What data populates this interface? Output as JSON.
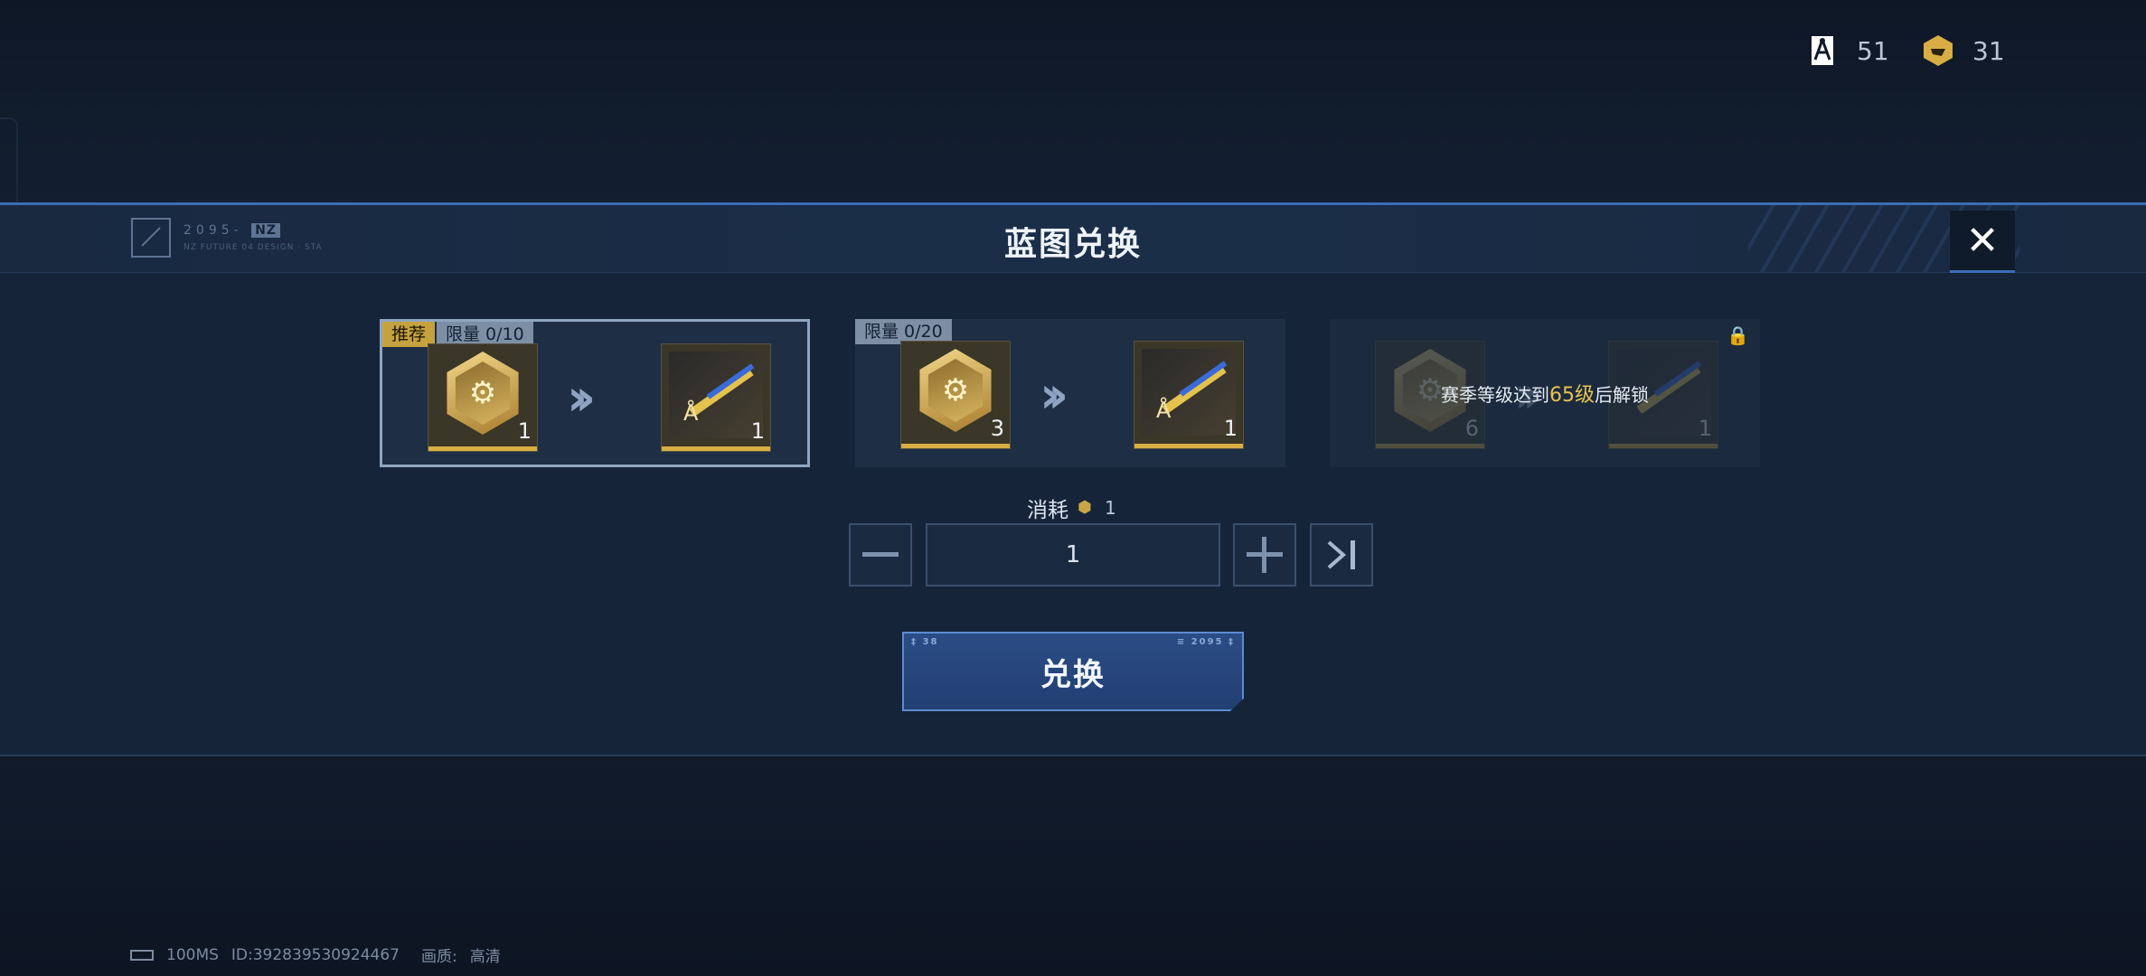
{
  "currencies": [
    {
      "icon": "blueprint-icon",
      "value": "51"
    },
    {
      "icon": "gold-crate-icon",
      "value": "31"
    }
  ],
  "modal": {
    "title": "蓝图兑换",
    "close_symbol": "✕",
    "logo": {
      "code": "2095-",
      "tag": "NZ",
      "subtitle": "NZ FUTURE 04 DESIGN · STA"
    }
  },
  "recipes": [
    {
      "recommended": "推荐",
      "limit": "限量 0/10",
      "input_count": "1",
      "output_count": "1",
      "selected": true
    },
    {
      "limit": "限量 0/20",
      "input_count": "3",
      "output_count": "1",
      "selected": false
    },
    {
      "input_count": "6",
      "output_count": "1",
      "locked": true,
      "lock_text_before": "赛季等级达到",
      "lock_text_level": "65级",
      "lock_text_after": "后解锁"
    }
  ],
  "consume": {
    "label": "消耗",
    "amount": "1"
  },
  "quantity": {
    "value": "1"
  },
  "exchange_button": {
    "label": "兑换"
  },
  "status_bar": {
    "ping": "100MS",
    "id": "ID:392839530924467",
    "quality_label": "画质:",
    "quality_value": "高清"
  },
  "colors": {
    "accent": "#3a6db5",
    "gold": "#d8ae44",
    "highlight": "#e8c14e"
  }
}
